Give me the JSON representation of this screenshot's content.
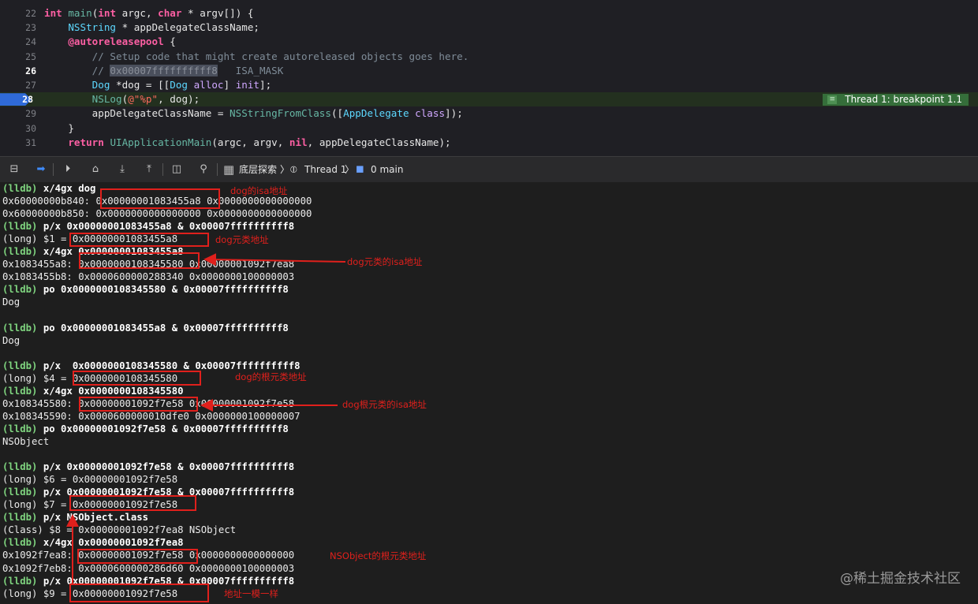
{
  "editor": {
    "badge_icon": "≡",
    "badge": "Thread 1: breakpoint 1.1",
    "lines": [
      {
        "num": "22",
        "tokens": [
          [
            "kw",
            "int"
          ],
          [
            "pl",
            " "
          ],
          [
            "fn",
            "main"
          ],
          [
            "pl",
            "("
          ],
          [
            "kw",
            "int"
          ],
          [
            "pl",
            " argc, "
          ],
          [
            "kw",
            "char"
          ],
          [
            "pl",
            " * argv[]) {"
          ]
        ]
      },
      {
        "num": "23",
        "tokens": [
          [
            "pl",
            "    "
          ],
          [
            "ty",
            "NSString"
          ],
          [
            "pl",
            " * appDelegateClassName;"
          ]
        ]
      },
      {
        "num": "24",
        "tokens": [
          [
            "pl",
            "    "
          ],
          [
            "kw",
            "@autoreleasepool"
          ],
          [
            "pl",
            " {"
          ]
        ]
      },
      {
        "num": "25",
        "tokens": [
          [
            "cm",
            "        // Setup code that might create autoreleased objects goes here."
          ]
        ]
      },
      {
        "num": "26",
        "tokens": [
          [
            "cm",
            "        // "
          ],
          [
            "sel",
            "0x00007ffffffffff8"
          ],
          [
            "cm",
            "   ISA_MASK"
          ]
        ]
      },
      {
        "num": "27",
        "tokens": [
          [
            "pl",
            "        "
          ],
          [
            "ty",
            "Dog"
          ],
          [
            "pl",
            " *dog = [["
          ],
          [
            "ty",
            "Dog"
          ],
          [
            "pl",
            " "
          ],
          [
            "cls",
            "alloc"
          ],
          [
            "pl",
            "] "
          ],
          [
            "cls",
            "init"
          ],
          [
            "pl",
            "];"
          ]
        ]
      },
      {
        "num": "28",
        "tokens": [
          [
            "pl",
            "        "
          ],
          [
            "fn",
            "NSLog"
          ],
          [
            "pl",
            "("
          ],
          [
            "str",
            "@\"%p\""
          ],
          [
            "pl",
            ", dog);"
          ]
        ]
      },
      {
        "num": "29",
        "tokens": [
          [
            "pl",
            "        appDelegateClassName = "
          ],
          [
            "fn",
            "NSStringFromClass"
          ],
          [
            "pl",
            "(["
          ],
          [
            "ty",
            "AppDelegate"
          ],
          [
            "pl",
            " "
          ],
          [
            "cls",
            "class"
          ],
          [
            "pl",
            "]);"
          ]
        ]
      },
      {
        "num": "30",
        "tokens": [
          [
            "pl",
            "    }"
          ]
        ]
      },
      {
        "num": "31",
        "tokens": [
          [
            "pl",
            "    "
          ],
          [
            "kw",
            "return"
          ],
          [
            "pl",
            " "
          ],
          [
            "fn",
            "UIApplicationMain"
          ],
          [
            "pl",
            "(argc, argv, "
          ],
          [
            "kw",
            "nil"
          ],
          [
            "pl",
            ", appDelegateClassName);"
          ]
        ]
      }
    ],
    "current_line": "28"
  },
  "debugbar": {
    "buttons": [
      {
        "name": "hide-debug-area-icon",
        "glyph": "⊟"
      },
      {
        "name": "breakpoints-toggle-icon",
        "glyph": "➡"
      },
      {
        "name": "continue-icon",
        "glyph": "⏵"
      },
      {
        "name": "step-over-icon",
        "glyph": "⌂"
      },
      {
        "name": "step-into-icon",
        "glyph": "⤓"
      },
      {
        "name": "step-out-icon",
        "glyph": "⤒"
      },
      {
        "name": "view-hierarchy-icon",
        "glyph": "◫"
      },
      {
        "name": "memory-graph-icon",
        "glyph": "⚲"
      }
    ],
    "target": "底层探索",
    "thread": "Thread 1",
    "frame": "0 main"
  },
  "console": {
    "lines": [
      {
        "cmd": true,
        "text": "x/4gx dog"
      },
      {
        "cmd": false,
        "text": "0x60000000b840: 0x00000001083455a8 0x0000000000000000"
      },
      {
        "cmd": false,
        "text": "0x60000000b850: 0x0000000000000000 0x0000000000000000"
      },
      {
        "cmd": true,
        "text": "p/x 0x00000001083455a8 & 0x00007ffffffffff8"
      },
      {
        "cmd": false,
        "text": "(long) $1 = 0x00000001083455a8"
      },
      {
        "cmd": true,
        "text": "x/4gx 0x00000001083455a8"
      },
      {
        "cmd": false,
        "text": "0x1083455a8: 0x0000000108345580 0x00000001092f7ea8"
      },
      {
        "cmd": false,
        "text": "0x1083455b8: 0x0000600000288340 0x0000000100000003"
      },
      {
        "cmd": true,
        "text": "po 0x0000000108345580 & 0x00007ffffffffff8"
      },
      {
        "cmd": false,
        "text": "Dog"
      },
      {
        "cmd": false,
        "text": ""
      },
      {
        "cmd": true,
        "text": "po 0x00000001083455a8 & 0x00007ffffffffff8"
      },
      {
        "cmd": false,
        "text": "Dog"
      },
      {
        "cmd": false,
        "text": ""
      },
      {
        "cmd": true,
        "text": "p/x  0x0000000108345580 & 0x00007ffffffffff8"
      },
      {
        "cmd": false,
        "text": "(long) $4 = 0x0000000108345580"
      },
      {
        "cmd": true,
        "text": "x/4gx 0x0000000108345580"
      },
      {
        "cmd": false,
        "text": "0x108345580: 0x00000001092f7e58 0x00000001092f7e58"
      },
      {
        "cmd": false,
        "text": "0x108345590: 0x0000600000010dfe0 0x0000000100000007"
      },
      {
        "cmd": true,
        "text": "po 0x00000001092f7e58 & 0x00007ffffffffff8"
      },
      {
        "cmd": false,
        "text": "NSObject"
      },
      {
        "cmd": false,
        "text": ""
      },
      {
        "cmd": true,
        "text": "p/x 0x00000001092f7e58 & 0x00007ffffffffff8"
      },
      {
        "cmd": false,
        "text": "(long) $6 = 0x00000001092f7e58"
      },
      {
        "cmd": true,
        "text": "p/x 0x00000001092f7e58 & 0x00007ffffffffff8"
      },
      {
        "cmd": false,
        "text": "(long) $7 = 0x00000001092f7e58"
      },
      {
        "cmd": true,
        "text": "p/x NSObject.class"
      },
      {
        "cmd": false,
        "text": "(Class) $8 = 0x00000001092f7ea8 NSObject"
      },
      {
        "cmd": true,
        "text": "x/4gx 0x00000001092f7ea8"
      },
      {
        "cmd": false,
        "text": "0x1092f7ea8: 0x00000001092f7e58 0x0000000000000000"
      },
      {
        "cmd": false,
        "text": "0x1092f7eb8: 0x0000600000286d60 0x0000000100000003"
      },
      {
        "cmd": true,
        "text": "p/x 0x00000001092f7e58 & 0x00007ffffffffff8"
      },
      {
        "cmd": false,
        "text": "(long) $9 = 0x00000001092f7e58"
      }
    ],
    "prompt": "(lldb) "
  },
  "annotations": {
    "notes": [
      {
        "text": "dog的isa地址"
      },
      {
        "text": "dog元类地址"
      },
      {
        "text": "dog元类的isa地址"
      },
      {
        "text": "dog的根元类地址"
      },
      {
        "text": "dog根元类的isa地址"
      },
      {
        "text": "NSObject的根元类地址"
      },
      {
        "text": "地址一模一样"
      }
    ],
    "color": "#e0201c"
  },
  "watermark": "@稀土掘金技术社区"
}
